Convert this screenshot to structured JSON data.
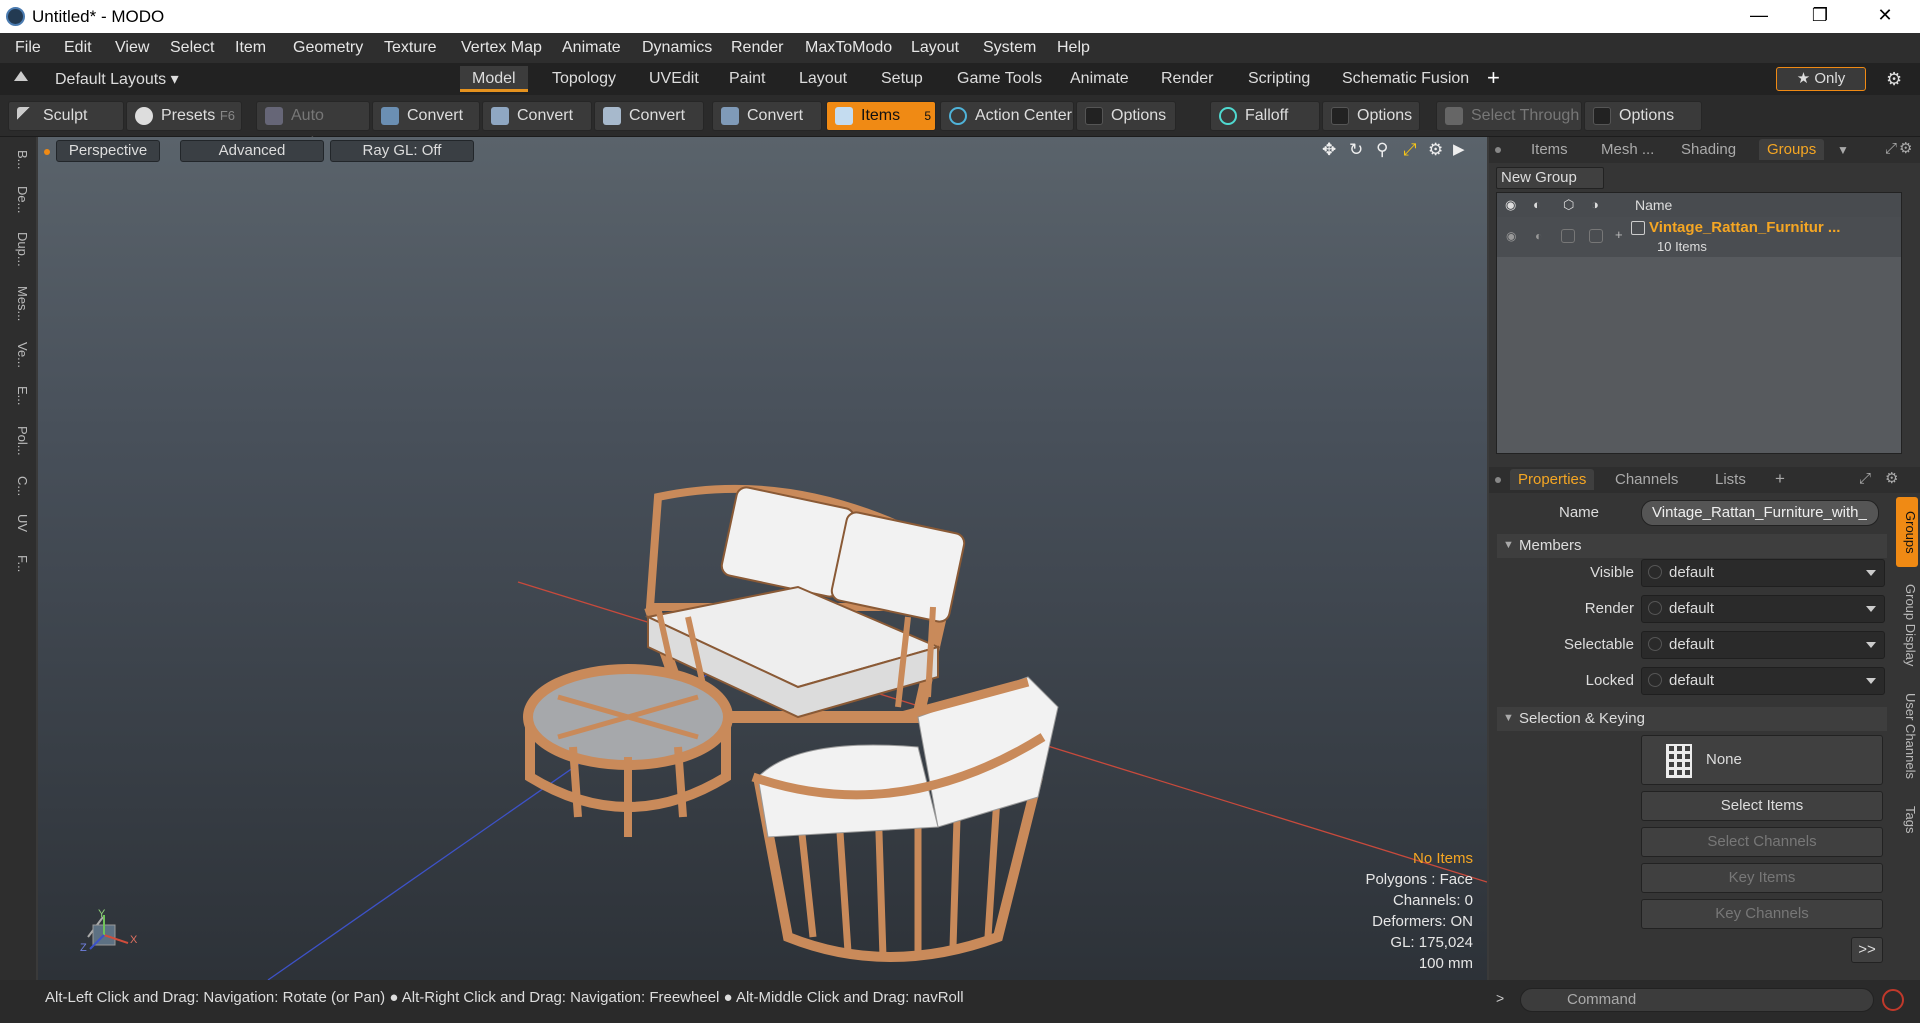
{
  "window": {
    "title": "Untitled* - MODO",
    "minimize": "—",
    "maximize": "❐",
    "close": "✕"
  },
  "menu": [
    "File",
    "Edit",
    "View",
    "Select",
    "Item",
    "Geometry",
    "Texture",
    "Vertex Map",
    "Animate",
    "Dynamics",
    "Render",
    "MaxToModo",
    "Layout",
    "System",
    "Help"
  ],
  "layouts": {
    "dropdown": "Default Layouts ▾",
    "tabs": [
      "Model",
      "Topology",
      "UVEdit",
      "Paint",
      "Layout",
      "Setup",
      "Game Tools",
      "Animate",
      "Render",
      "Scripting",
      "Schematic Fusion"
    ],
    "add": "+",
    "only": "★ Only"
  },
  "toolbar": {
    "sculpt": "Sculpt",
    "presets": "Presets",
    "presets_key": "F6",
    "auto_select": "Auto Select",
    "convert1": "Convert",
    "convert2": "Convert",
    "convert3": "Convert",
    "convert4": "Convert",
    "items": "Items",
    "items_count": "5",
    "action_center": "Action Center",
    "options1": "Options",
    "falloff": "Falloff",
    "options2": "Options",
    "select_through": "Select Through",
    "options3": "Options"
  },
  "left_tools": [
    "B...",
    "De...",
    "Dup...",
    "Mes...",
    "Ve...",
    "E...",
    "Pol...",
    "C...",
    "UV",
    "F..."
  ],
  "viewport": {
    "perspective": "Perspective",
    "advanced": "Advanced",
    "raygl": "Ray GL: Off",
    "axis_x": "X",
    "axis_y": "Y",
    "axis_z": "Z"
  },
  "stats": {
    "no_items": "No Items",
    "polygons": "Polygons : Face",
    "channels": "Channels: 0",
    "deformers": "Deformers: ON",
    "gl": "GL: 175,024",
    "unit": "100 mm"
  },
  "groups_panel": {
    "tabs": [
      "Items",
      "Mesh ...",
      "Shading",
      "Groups"
    ],
    "new_group": "New Group",
    "col_name": "Name",
    "group_name": "Vintage_Rattan_Furnitur ...",
    "group_count": "10 Items"
  },
  "properties": {
    "tabs": [
      "Properties",
      "Channels",
      "Lists",
      "+"
    ],
    "name_label": "Name",
    "name_value": "Vintage_Rattan_Furniture_with_",
    "members": "Members",
    "visible_label": "Visible",
    "visible": "default",
    "render_label": "Render",
    "render": "default",
    "selectable_label": "Selectable",
    "selectable": "default",
    "locked_label": "Locked",
    "locked": "default",
    "selection_keying": "Selection & Keying",
    "none": "None",
    "select_items": "Select Items",
    "select_channels": "Select Channels",
    "key_items": "Key Items",
    "key_channels": "Key Channels",
    "more": ">>",
    "side_tabs": [
      "Groups",
      "Group Display",
      "User Channels",
      "Tags"
    ]
  },
  "status": {
    "hint1": "Alt-Left Click and Drag: Navigation: Rotate (or Pan)",
    "hint2": "Alt-Right Click and Drag: Navigation: Freewheel",
    "hint3": "Alt-Middle Click and Drag: navRoll",
    "command_placeholder": "Command"
  },
  "colors": {
    "accent": "#f08a14",
    "group_name": "#f5a623",
    "rattan": "#c98a5a",
    "cushion": "#f2f2f2"
  }
}
